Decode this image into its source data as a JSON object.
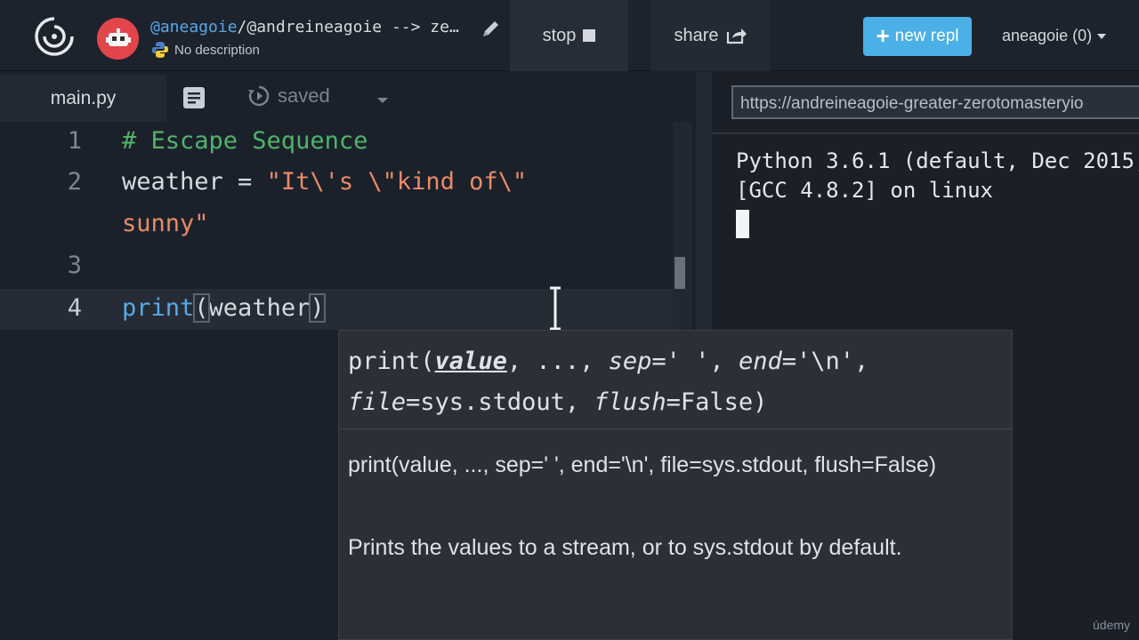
{
  "header": {
    "repl_user": "@aneagoie",
    "repl_path_rest": "/@andreineagoie --> ze…",
    "description": "No description",
    "stop_label": "stop",
    "share_label": "share",
    "new_repl_label": "new repl",
    "user_menu_label": "aneagoie (0)"
  },
  "editor": {
    "tab_label": "main.py",
    "saved_label": "saved",
    "lines": [
      {
        "num": "1",
        "text": "# Escape Sequence"
      },
      {
        "num": "2",
        "name": "weather",
        "op": " = ",
        "value_part1": "\"It\\'s \\\"kind of\\\"",
        "value_part2": "sunny\""
      },
      {
        "num": "3",
        "text": ""
      },
      {
        "num": "4",
        "fn": "print",
        "paren_open": "(",
        "arg": "weather",
        "paren_close": ")"
      }
    ]
  },
  "console": {
    "url": "https://andreineagoie-greater-zerotomasteryio",
    "line1": "Python 3.6.1 (default, Dec 2015,",
    "line2": "[GCC 4.8.2] on linux"
  },
  "tooltip": {
    "sig_fn": "print(",
    "sig_value": "value",
    "sig_rest1": ", ..., ",
    "sig_sep": "sep",
    "sig_sep_val": "=' ', ",
    "sig_end": "end",
    "sig_end_val": "='\\n',",
    "sig_file": "file",
    "sig_file_val": "=sys.stdout, ",
    "sig_flush": "flush",
    "sig_flush_val": "=False)",
    "doc_line1": "print(value, ..., sep=' ', end='\\n', file=sys.stdout, flush=False)",
    "doc_line2": "Prints the values to a stream, or to sys.stdout by default."
  },
  "watermark": "údemy",
  "colors": {
    "accent": "#4ab0e6",
    "avatar": "#e2464b",
    "comment": "#4fb36a",
    "string": "#e88a67",
    "keyword": "#5aa9e6"
  }
}
